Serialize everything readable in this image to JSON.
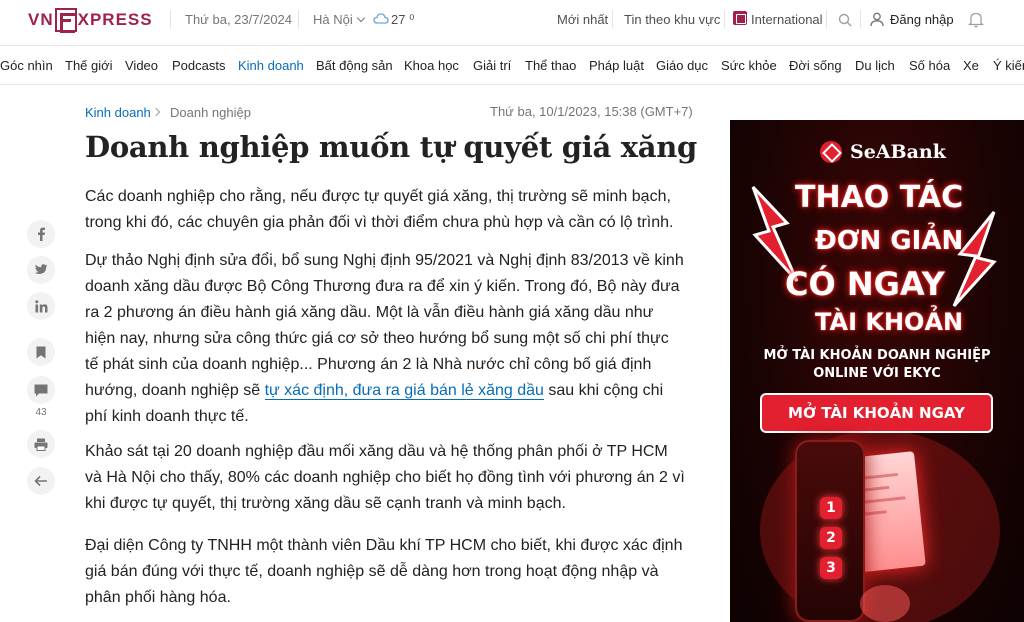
{
  "header": {
    "logo": {
      "left": "VN",
      "right": "XPRESS"
    },
    "date": "Thứ ba, 23/7/2024",
    "location": "Hà Nội",
    "temperature": "27 ⁰",
    "latest": "Mới nhất",
    "local_news": "Tin theo khu vực",
    "international": "International",
    "login": "Đăng nhập",
    "icons": [
      "cloud-icon",
      "chevron-down-icon",
      "international-icon",
      "search-icon",
      "user-icon",
      "bell-icon"
    ]
  },
  "nav": {
    "items": [
      "Góc nhìn",
      "Thế giới",
      "Video",
      "Podcasts",
      "Kinh doanh",
      "Bất động sản",
      "Khoa học",
      "Giải trí",
      "Thể thao",
      "Pháp luật",
      "Giáo dục",
      "Sức khỏe",
      "Đời sống",
      "Du lịch",
      "Số hóa",
      "Xe",
      "Ý kiến"
    ],
    "active": "Kinh doanh",
    "active_color": "#076db6"
  },
  "breadcrumb": {
    "category": "Kinh doanh",
    "subcategory": "Doanh nghiệp"
  },
  "article": {
    "date": "Thứ ba, 10/1/2023, 15:38 (GMT+7)",
    "title": "Doanh nghiệp muốn tự quyết giá xăng",
    "lead": "Các doanh nghiệp cho rằng, nếu được tự quyết giá xăng, thị trường sẽ minh bạch, trong khi đó, các chuyên gia phản đối vì thời điểm chưa phù hợp và cần có lộ trình.",
    "p1_before": "Dự thảo Nghị định sửa đổi, bổ sung Nghị định 95/2021 và Nghị định 83/2013 về kinh doanh xăng dầu được Bộ Công Thương đưa ra để xin ý kiến. Trong đó, Bộ này đưa ra 2 phương án điều hành giá xăng dầu. Một là vẫn điều hành giá xăng dầu như hiện nay, nhưng sửa công thức giá cơ sở theo hướng bổ sung một số chi phí thực tế phát sinh của doanh nghiệp... Phương án 2 là Nhà nước chỉ công bố giá định hướng, doanh nghiệp sẽ ",
    "p1_link": "tự xác định, đưa ra giá bán lẻ xăng dầu",
    "p1_after": " sau khi cộng chi phí kinh doanh thực tế.",
    "p2": "Khảo sát tại 20 doanh nghiệp đầu mối xăng dầu và hệ thống phân phối ở TP HCM và Hà Nội cho thấy, 80% các doanh nghiệp cho biết họ đồng tình với phương án 2 vì khi được tự quyết, thị trường xăng dầu sẽ cạnh tranh và minh bạch.",
    "p3": "Đại diện Công ty TNHH một thành viên Dầu khí TP HCM cho biết, khi được xác định giá bán đúng với thực tế, doanh nghiệp sẽ dễ dàng hơn trong hoạt động nhập và phân phối hàng hóa."
  },
  "social": {
    "icons": [
      "facebook-icon",
      "twitter-icon",
      "linkedin-icon",
      "bookmark-icon",
      "comment-icon",
      "print-icon",
      "back-icon"
    ],
    "comment_count": "43"
  },
  "ad": {
    "brand": "SeABank",
    "line1": "THAO TÁC",
    "line2": "ĐƠN GIẢN",
    "line3": "CÓ NGAY",
    "line4": "TÀI KHOẢN",
    "sub1": "MỞ TÀI KHOẢN DOANH NGHIỆP",
    "sub2": "ONLINE VỚI EKYC",
    "button": "MỞ TÀI KHOẢN NGAY",
    "steps": [
      "1",
      "2",
      "3"
    ],
    "accent": "#e3202f"
  },
  "colors": {
    "brand": "#9f224e",
    "link": "#076db6"
  }
}
